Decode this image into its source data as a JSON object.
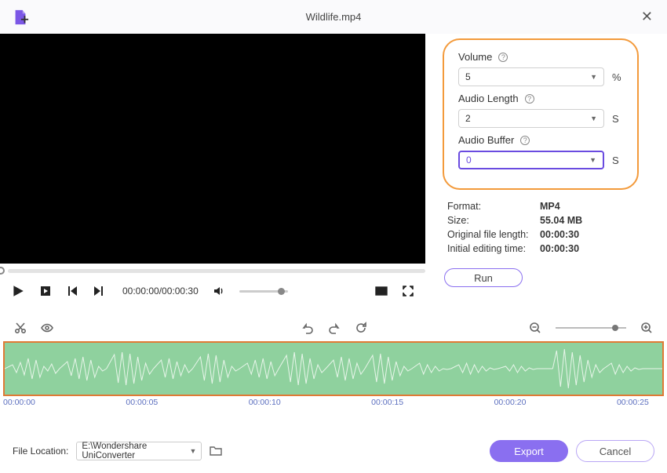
{
  "title": "Wildlife.mp4",
  "params": {
    "volume_label": "Volume",
    "volume_value": "5",
    "volume_unit": "%",
    "audiolen_label": "Audio Length",
    "audiolen_value": "2",
    "audiolen_unit": "S",
    "audiobuf_label": "Audio Buffer",
    "audiobuf_value": "0",
    "audiobuf_unit": "S"
  },
  "meta": {
    "format_k": "Format:",
    "format_v": "MP4",
    "size_k": "Size:",
    "size_v": "55.04 MB",
    "orig_k": "Original file length:",
    "orig_v": "00:00:30",
    "init_k": "Initial editing time:",
    "init_v": "00:00:30"
  },
  "run_label": "Run",
  "player": {
    "time": "00:00:00/00:00:30"
  },
  "ruler": [
    "00:00:00",
    "00:00:05",
    "00:00:10",
    "00:00:15",
    "00:00:20",
    "00:00:25"
  ],
  "footer": {
    "label": "File Location:",
    "path": "E:\\Wondershare UniConverter",
    "export": "Export",
    "cancel": "Cancel"
  }
}
